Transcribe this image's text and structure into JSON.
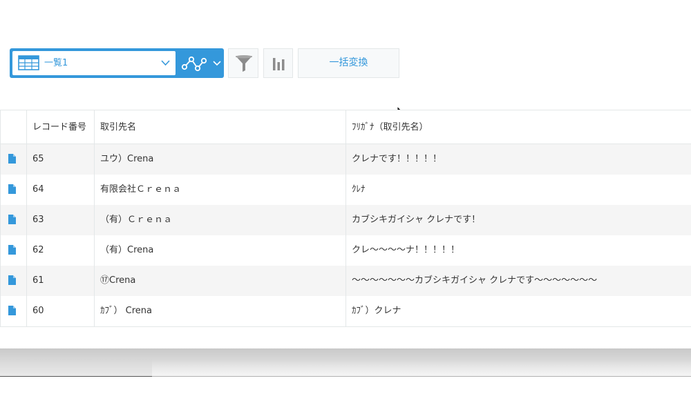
{
  "toolbar": {
    "view_name": "一覧1",
    "bulk_button_label": "一括変換",
    "accent_color": "#3498db"
  },
  "table": {
    "columns": [
      "",
      "レコード番号",
      "取引先名",
      "ﾌﾘｶﾞﾅ（取引先名）"
    ],
    "rows": [
      {
        "record_no": "65",
        "name": "ユウ）Crena",
        "kana": "クレナです！！！！！"
      },
      {
        "record_no": "64",
        "name": "有限会社Ｃｒｅｎａ",
        "kana": "ｸﾚﾅ"
      },
      {
        "record_no": "63",
        "name": "（有）Ｃｒｅｎａ",
        "kana": "カブシキガイシャ クレナです！"
      },
      {
        "record_no": "62",
        "name": "（有）Crena",
        "kana": "クレ〜〜〜〜ナ！！！！！"
      },
      {
        "record_no": "61",
        "name": "⑰Crena",
        "kana": "〜〜〜〜〜〜〜カブシキガイシャ クレナです〜〜〜〜〜〜〜"
      },
      {
        "record_no": "60",
        "name": "ｶﾌﾞ）  Crena",
        "kana": "ｶﾌﾞ）クレナ"
      }
    ]
  },
  "icons": {
    "view_type": "table-view-icon",
    "graph": "graph-icon",
    "filter": "filter-icon",
    "chart": "bar-chart-icon",
    "record_detail": "document-icon",
    "pointer": "cursor-icon"
  }
}
